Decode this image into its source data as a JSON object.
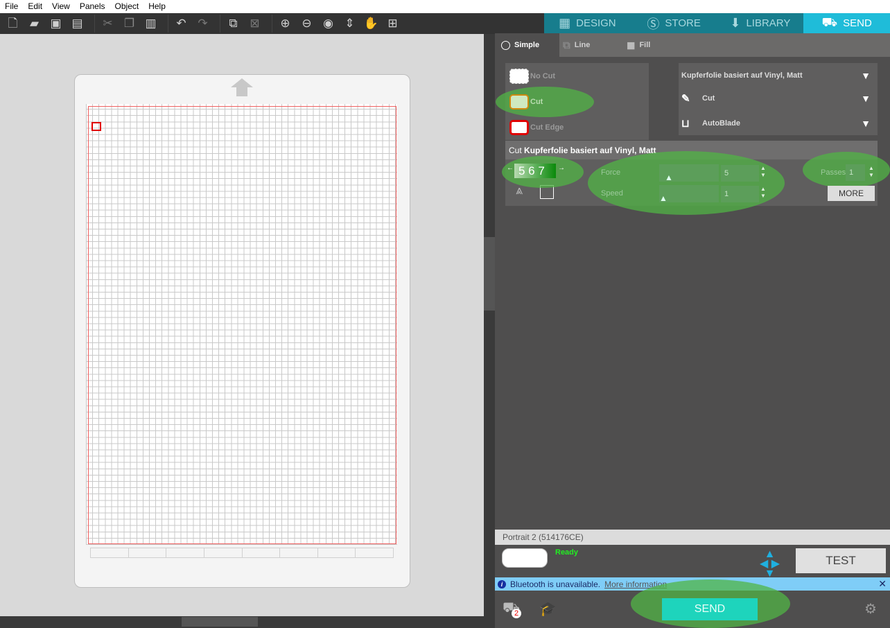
{
  "menu": [
    "File",
    "Edit",
    "View",
    "Panels",
    "Object",
    "Help"
  ],
  "toolbar_icons": [
    "new-file",
    "open",
    "save",
    "print",
    "cut",
    "copy",
    "paste",
    "undo",
    "redo",
    "group",
    "ungroup",
    "zoom-in",
    "zoom-out",
    "zoom-fit",
    "move-down",
    "pan-hand",
    "zoom-select"
  ],
  "tabs": [
    {
      "label": "DESIGN",
      "icon": "grid-icon"
    },
    {
      "label": "STORE",
      "icon": "store-s-icon"
    },
    {
      "label": "LIBRARY",
      "icon": "library-icon"
    },
    {
      "label": "SEND",
      "icon": "cutter-icon"
    }
  ],
  "active_tab": "SEND",
  "subtabs": [
    "Simple",
    "Line",
    "Fill"
  ],
  "cut_modes": [
    "No Cut",
    "Cut",
    "Cut Edge"
  ],
  "selected_cut_mode": "Cut",
  "material": "Kupferfolie basiert auf Vinyl, Matt",
  "action": "Cut",
  "tool": "AutoBlade",
  "cut_header": {
    "prefix": "Cut",
    "material": "Kupferfolie basiert auf Vinyl, Matt"
  },
  "blade_digits": "5 6 7",
  "settings": {
    "force_label": "Force",
    "force": "5",
    "speed_label": "Speed",
    "speed": "1",
    "passes_label": "Passes",
    "passes": "1",
    "more": "MORE"
  },
  "device": {
    "name": "Portrait 2 (514176CE)",
    "status": "Ready",
    "test": "TEST"
  },
  "bluetooth": {
    "message": "Bluetooth is unavailable.",
    "link": "More information"
  },
  "send_label": "SEND",
  "queue_badge": "2",
  "colors": {
    "tab_bg": "#177d8d",
    "tab_active": "#1fbcd9",
    "send_button": "#1ed4bc",
    "ready": "#22ee22",
    "highlight": "#50b446"
  }
}
